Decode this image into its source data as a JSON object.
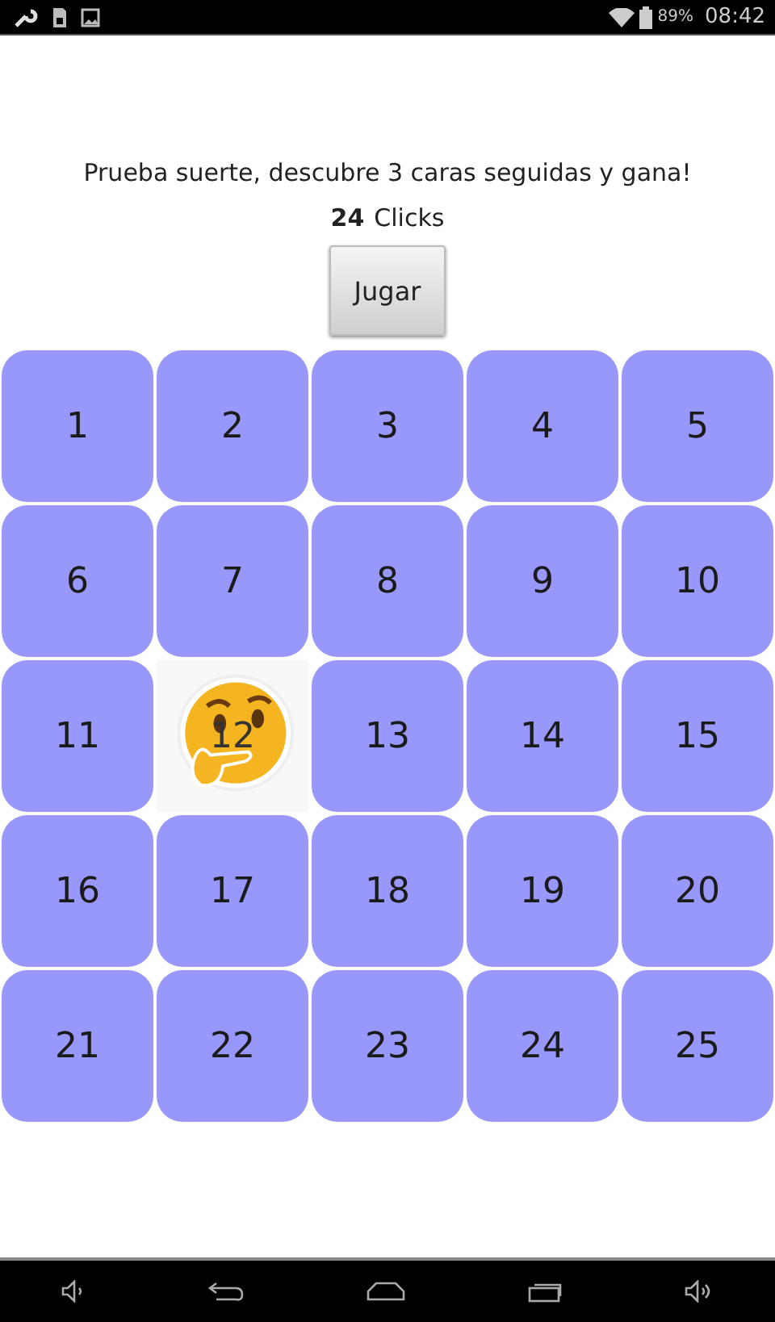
{
  "status_bar": {
    "battery": "89%",
    "time": "08:42"
  },
  "instructions": "Prueba suerte, descubre 3 caras seguidas y gana!",
  "clicks": {
    "count": "24",
    "label": "Clicks"
  },
  "play_button": "Jugar",
  "cells": [
    {
      "label": "1",
      "revealed": false
    },
    {
      "label": "2",
      "revealed": false
    },
    {
      "label": "3",
      "revealed": false
    },
    {
      "label": "4",
      "revealed": false
    },
    {
      "label": "5",
      "revealed": false
    },
    {
      "label": "6",
      "revealed": false
    },
    {
      "label": "7",
      "revealed": false
    },
    {
      "label": "8",
      "revealed": false
    },
    {
      "label": "9",
      "revealed": false
    },
    {
      "label": "10",
      "revealed": false
    },
    {
      "label": "11",
      "revealed": false
    },
    {
      "label": "12",
      "revealed": true
    },
    {
      "label": "13",
      "revealed": false
    },
    {
      "label": "14",
      "revealed": false
    },
    {
      "label": "15",
      "revealed": false
    },
    {
      "label": "16",
      "revealed": false
    },
    {
      "label": "17",
      "revealed": false
    },
    {
      "label": "18",
      "revealed": false
    },
    {
      "label": "19",
      "revealed": false
    },
    {
      "label": "20",
      "revealed": false
    },
    {
      "label": "21",
      "revealed": false
    },
    {
      "label": "22",
      "revealed": false
    },
    {
      "label": "23",
      "revealed": false
    },
    {
      "label": "24",
      "revealed": false
    },
    {
      "label": "25",
      "revealed": false
    }
  ]
}
